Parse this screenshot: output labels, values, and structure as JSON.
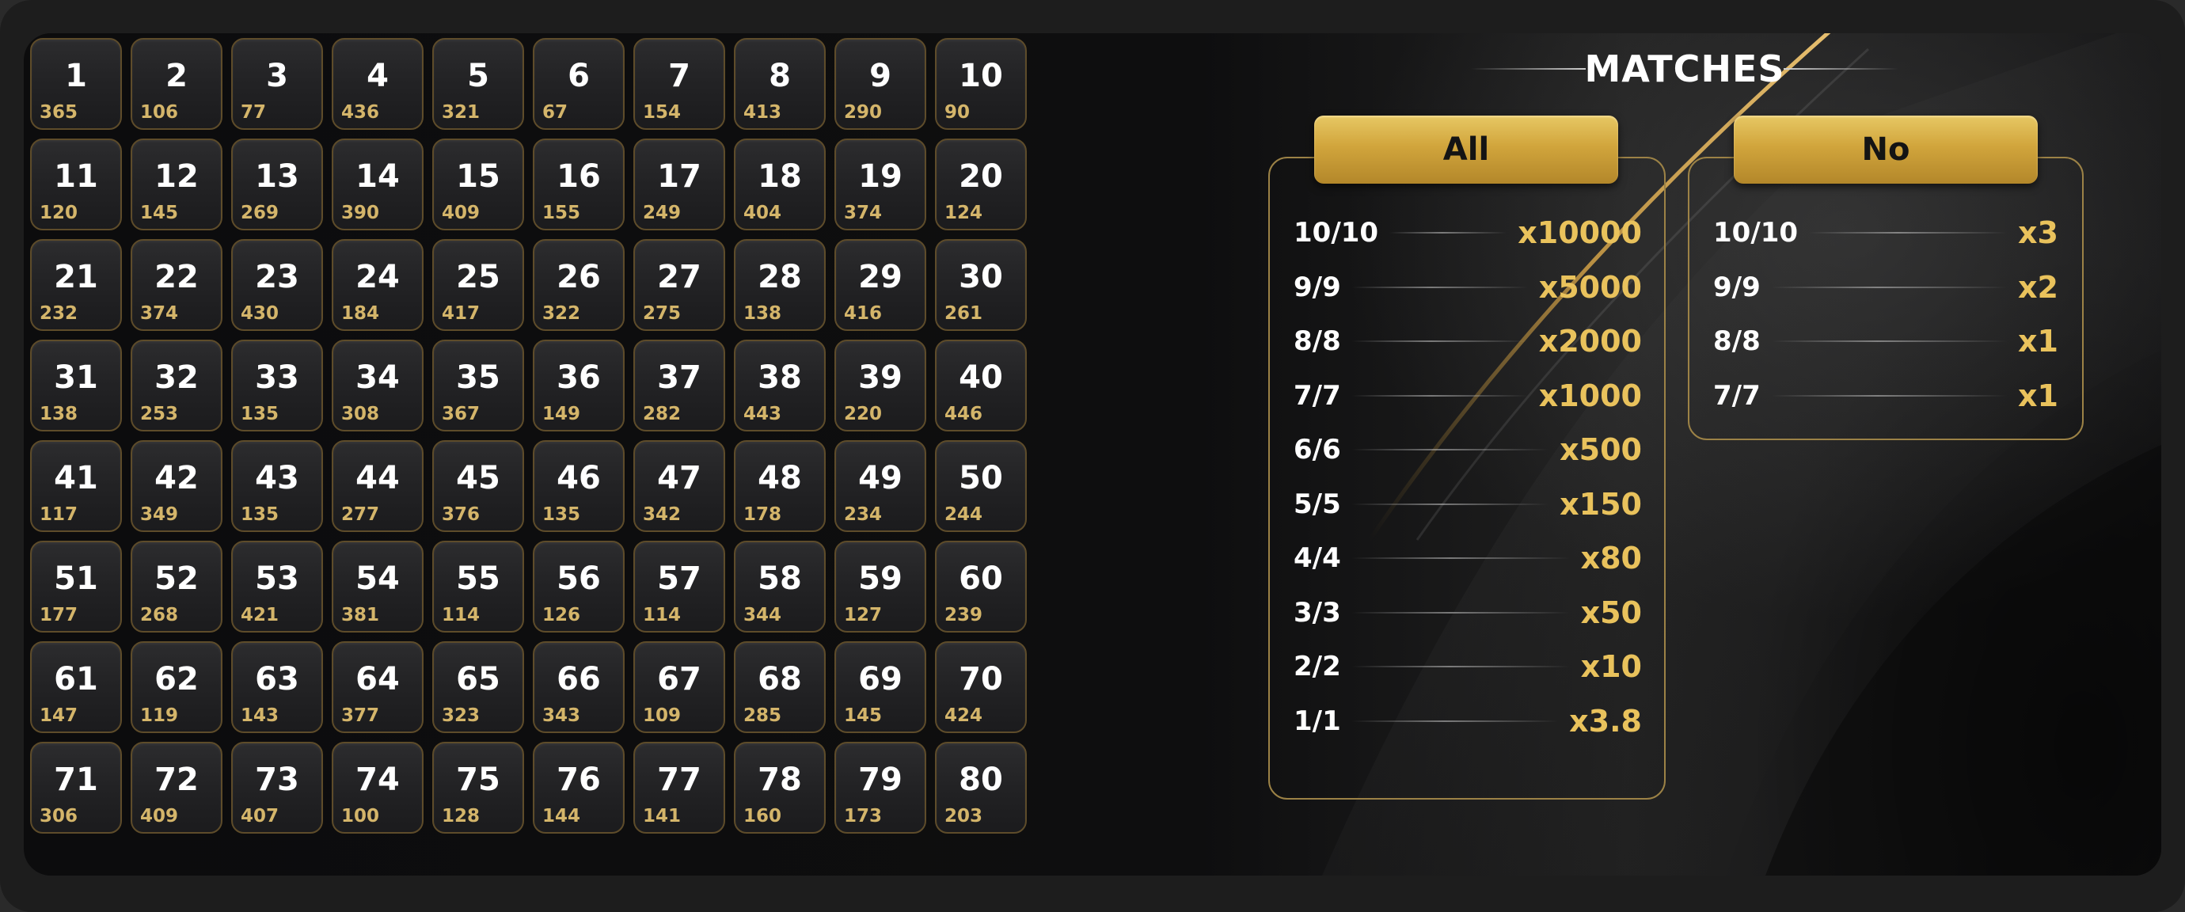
{
  "grid": {
    "cells": [
      {
        "n": "1",
        "c": "365"
      },
      {
        "n": "2",
        "c": "106"
      },
      {
        "n": "3",
        "c": "77"
      },
      {
        "n": "4",
        "c": "436"
      },
      {
        "n": "5",
        "c": "321"
      },
      {
        "n": "6",
        "c": "67"
      },
      {
        "n": "7",
        "c": "154"
      },
      {
        "n": "8",
        "c": "413"
      },
      {
        "n": "9",
        "c": "290"
      },
      {
        "n": "10",
        "c": "90"
      },
      {
        "n": "11",
        "c": "120"
      },
      {
        "n": "12",
        "c": "145"
      },
      {
        "n": "13",
        "c": "269"
      },
      {
        "n": "14",
        "c": "390"
      },
      {
        "n": "15",
        "c": "409"
      },
      {
        "n": "16",
        "c": "155"
      },
      {
        "n": "17",
        "c": "249"
      },
      {
        "n": "18",
        "c": "404"
      },
      {
        "n": "19",
        "c": "374"
      },
      {
        "n": "20",
        "c": "124"
      },
      {
        "n": "21",
        "c": "232"
      },
      {
        "n": "22",
        "c": "374"
      },
      {
        "n": "23",
        "c": "430"
      },
      {
        "n": "24",
        "c": "184"
      },
      {
        "n": "25",
        "c": "417"
      },
      {
        "n": "26",
        "c": "322"
      },
      {
        "n": "27",
        "c": "275"
      },
      {
        "n": "28",
        "c": "138"
      },
      {
        "n": "29",
        "c": "416"
      },
      {
        "n": "30",
        "c": "261"
      },
      {
        "n": "31",
        "c": "138"
      },
      {
        "n": "32",
        "c": "253"
      },
      {
        "n": "33",
        "c": "135"
      },
      {
        "n": "34",
        "c": "308"
      },
      {
        "n": "35",
        "c": "367"
      },
      {
        "n": "36",
        "c": "149"
      },
      {
        "n": "37",
        "c": "282"
      },
      {
        "n": "38",
        "c": "443"
      },
      {
        "n": "39",
        "c": "220"
      },
      {
        "n": "40",
        "c": "446"
      },
      {
        "n": "41",
        "c": "117"
      },
      {
        "n": "42",
        "c": "349"
      },
      {
        "n": "43",
        "c": "135"
      },
      {
        "n": "44",
        "c": "277"
      },
      {
        "n": "45",
        "c": "376"
      },
      {
        "n": "46",
        "c": "135"
      },
      {
        "n": "47",
        "c": "342"
      },
      {
        "n": "48",
        "c": "178"
      },
      {
        "n": "49",
        "c": "234"
      },
      {
        "n": "50",
        "c": "244"
      },
      {
        "n": "51",
        "c": "177"
      },
      {
        "n": "52",
        "c": "268"
      },
      {
        "n": "53",
        "c": "421"
      },
      {
        "n": "54",
        "c": "381"
      },
      {
        "n": "55",
        "c": "114"
      },
      {
        "n": "56",
        "c": "126"
      },
      {
        "n": "57",
        "c": "114"
      },
      {
        "n": "58",
        "c": "344"
      },
      {
        "n": "59",
        "c": "127"
      },
      {
        "n": "60",
        "c": "239"
      },
      {
        "n": "61",
        "c": "147"
      },
      {
        "n": "62",
        "c": "119"
      },
      {
        "n": "63",
        "c": "143"
      },
      {
        "n": "64",
        "c": "377"
      },
      {
        "n": "65",
        "c": "323"
      },
      {
        "n": "66",
        "c": "343"
      },
      {
        "n": "67",
        "c": "109"
      },
      {
        "n": "68",
        "c": "285"
      },
      {
        "n": "69",
        "c": "145"
      },
      {
        "n": "70",
        "c": "424"
      },
      {
        "n": "71",
        "c": "306"
      },
      {
        "n": "72",
        "c": "409"
      },
      {
        "n": "73",
        "c": "407"
      },
      {
        "n": "74",
        "c": "100"
      },
      {
        "n": "75",
        "c": "128"
      },
      {
        "n": "76",
        "c": "144"
      },
      {
        "n": "77",
        "c": "141"
      },
      {
        "n": "78",
        "c": "160"
      },
      {
        "n": "79",
        "c": "173"
      },
      {
        "n": "80",
        "c": "203"
      }
    ]
  },
  "matches": {
    "title": "MATCHES",
    "all": {
      "tab_label": "All",
      "rows": [
        {
          "label": "10/10",
          "mult": "x10000"
        },
        {
          "label": "9/9",
          "mult": "x5000"
        },
        {
          "label": "8/8",
          "mult": "x2000"
        },
        {
          "label": "7/7",
          "mult": "x1000"
        },
        {
          "label": "6/6",
          "mult": "x500"
        },
        {
          "label": "5/5",
          "mult": "x150"
        },
        {
          "label": "4/4",
          "mult": "x80"
        },
        {
          "label": "3/3",
          "mult": "x50"
        },
        {
          "label": "2/2",
          "mult": "x10"
        },
        {
          "label": "1/1",
          "mult": "x3.8"
        }
      ]
    },
    "no": {
      "tab_label": "No",
      "rows": [
        {
          "label": "10/10",
          "mult": "x3"
        },
        {
          "label": "9/9",
          "mult": "x2"
        },
        {
          "label": "8/8",
          "mult": "x1"
        },
        {
          "label": "7/7",
          "mult": "x1"
        }
      ]
    }
  },
  "colors": {
    "gold": "#e9c25c",
    "cell_count": "#d4b56a",
    "border_gold": "#9c8246"
  }
}
